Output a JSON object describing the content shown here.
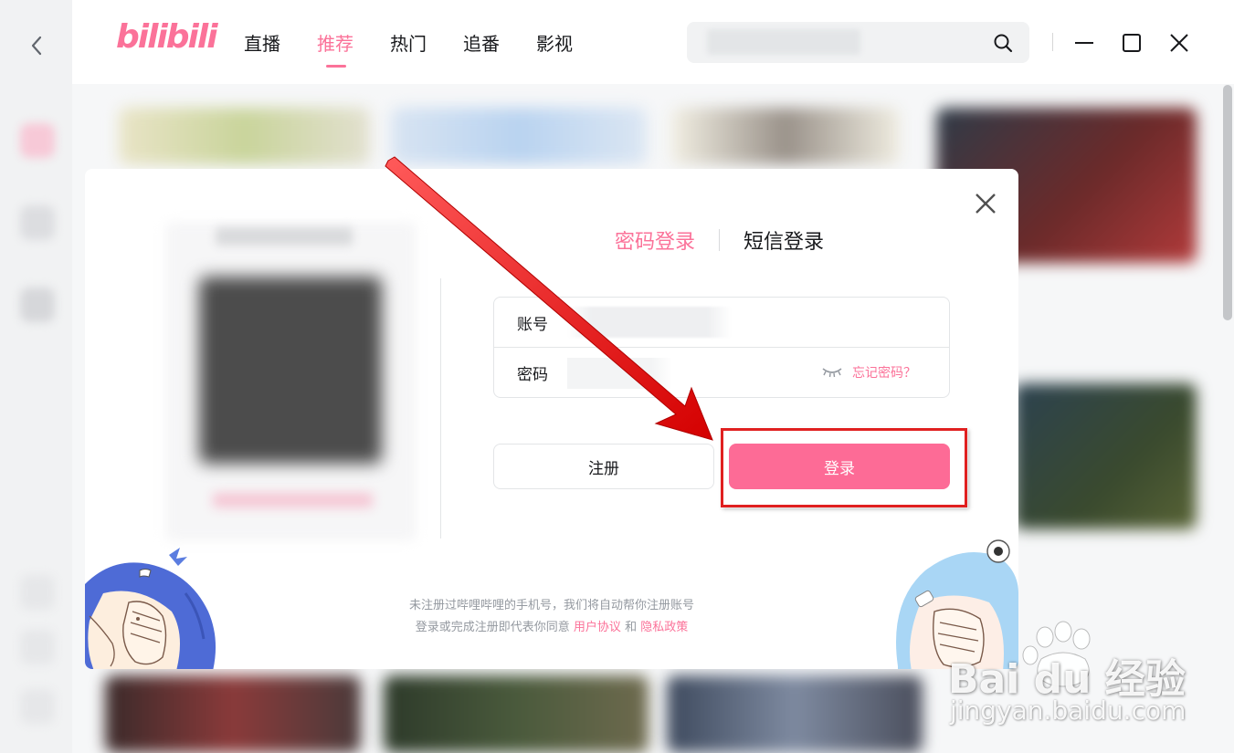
{
  "app": {
    "logo": "bilibili"
  },
  "nav": {
    "items": [
      {
        "label": "直播"
      },
      {
        "label": "推荐"
      },
      {
        "label": "热门"
      },
      {
        "label": "追番"
      },
      {
        "label": "影视"
      }
    ],
    "active_index": 1
  },
  "search": {
    "value": ""
  },
  "login_modal": {
    "tabs": [
      {
        "label": "密码登录",
        "active": true
      },
      {
        "label": "短信登录",
        "active": false
      }
    ],
    "account": {
      "label": "账号",
      "value": ""
    },
    "password": {
      "label": "密码",
      "value": "",
      "forgot_label": "忘记密码？"
    },
    "register_button": "注册",
    "login_button": "登录",
    "agreement": {
      "line1": "未注册过哔哩哔哩的手机号，我们将自动帮你注册账号",
      "line2_prefix": "登录或完成注册即代表你同意",
      "user_agreement": "用户协议",
      "and": "和",
      "privacy_policy": "隐私政策"
    }
  },
  "watermark": {
    "brand": "Bai du 经验",
    "url": "jingyan.baidu.com"
  },
  "colors": {
    "accent": "#fb7299",
    "login_button": "#fd6b96",
    "annotation_red": "#e02020"
  }
}
